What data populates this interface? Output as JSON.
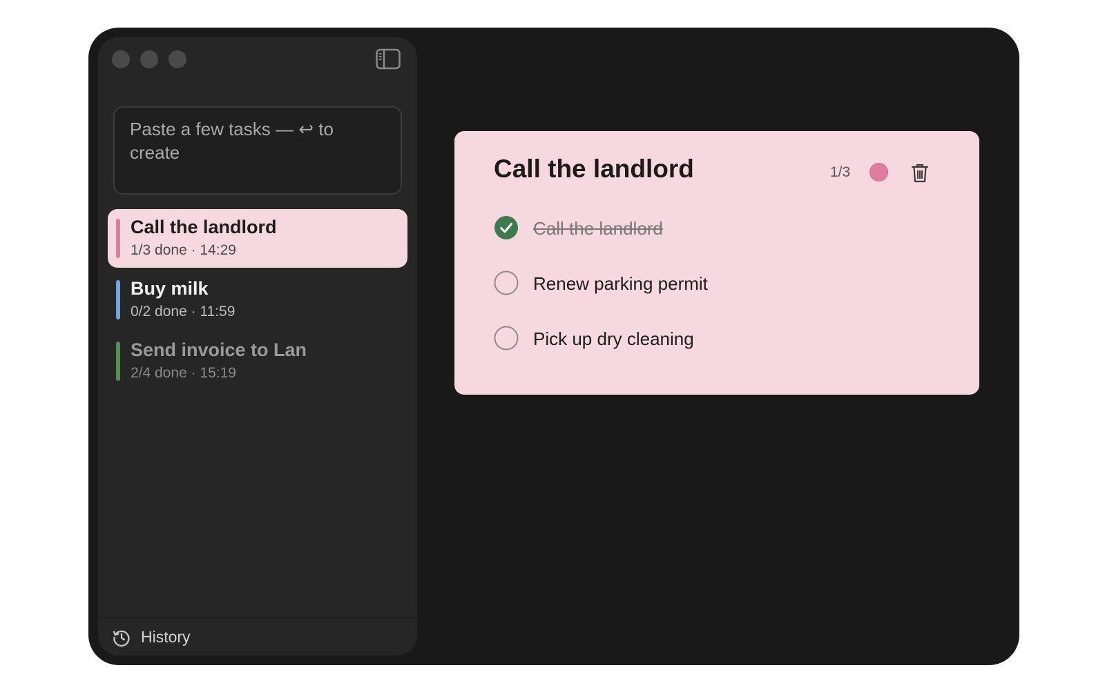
{
  "composer": {
    "placeholder": "Paste a few tasks — ↩ to create"
  },
  "tasks": [
    {
      "title": "Call the landlord",
      "meta": "1/3 done · 14:29",
      "color": "#e07ca0",
      "selected": true
    },
    {
      "title": "Buy milk",
      "meta": "0/2 done · 11:59",
      "color": "#6fa6df",
      "selected": false
    },
    {
      "title": "Send invoice to Lan",
      "meta": "2/4 done · 15:19",
      "color": "#4f8f4f",
      "selected": false
    }
  ],
  "footer": {
    "history_label": "History"
  },
  "detail": {
    "title": "Call the landlord",
    "progress": "1/3",
    "accent_color": "#e07ca0",
    "subtasks": [
      {
        "label": "Call the landlord",
        "done": true
      },
      {
        "label": "Renew parking permit",
        "done": false
      },
      {
        "label": "Pick up dry cleaning",
        "done": false
      }
    ]
  },
  "colors": {
    "window_bg": "#181918",
    "sidebar_bg": "#262626",
    "selected_bg": "#f6d8e0",
    "check_green": "#3d7a4e"
  }
}
